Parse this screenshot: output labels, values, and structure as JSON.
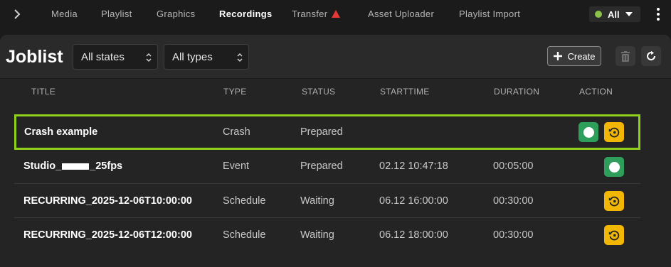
{
  "nav": {
    "tabs": [
      {
        "label": "Media"
      },
      {
        "label": "Playlist"
      },
      {
        "label": "Graphics"
      },
      {
        "label": "Recordings",
        "active": true
      },
      {
        "label": "Transfer",
        "warning": true
      },
      {
        "label": "Asset Uploader"
      },
      {
        "label": "Playlist Import"
      }
    ],
    "scope_filter": "All",
    "warning_color": "#e53935",
    "status_dot_color": "#8bc34a"
  },
  "joblist": {
    "title": "Joblist",
    "state_filter": "All states",
    "type_filter": "All types",
    "create_label": "Create",
    "columns": [
      "TITLE",
      "TYPE",
      "STATUS",
      "STARTTIME",
      "DURATION",
      "ACTION"
    ],
    "rows": [
      {
        "title": "Crash example",
        "type": "Crash",
        "status": "Prepared",
        "starttime": "",
        "duration": "",
        "actions": [
          "record-icon",
          "restart-icon"
        ],
        "selected": true
      },
      {
        "title_prefix": "Studio_",
        "title_suffix": "_25fps",
        "title_redacted": true,
        "type": "Event",
        "status": "Prepared",
        "starttime": "02.12 10:47:18",
        "duration": "00:05:00",
        "actions": [
          "record-icon"
        ]
      },
      {
        "title": "RECURRING_2025-12-06T10:00:00",
        "type": "Schedule",
        "status": "Waiting",
        "starttime": "06.12 16:00:00",
        "duration": "00:30:00",
        "actions": [
          "restart-icon"
        ]
      },
      {
        "title": "RECURRING_2025-12-06T12:00:00",
        "type": "Schedule",
        "status": "Waiting",
        "starttime": "06.12 18:00:00",
        "duration": "00:30:00",
        "actions": [
          "restart-icon"
        ]
      }
    ]
  },
  "colors": {
    "selection_outline": "#8fd11a",
    "record_button": "#2e9e5b",
    "restart_button": "#f2b705"
  }
}
